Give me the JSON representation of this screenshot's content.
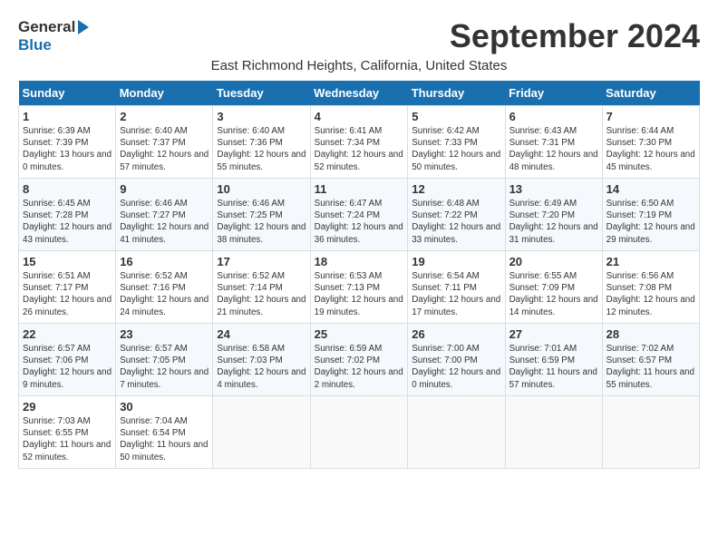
{
  "header": {
    "logo_line1": "General",
    "logo_line2": "Blue",
    "title": "September 2024",
    "location": "East Richmond Heights, California, United States"
  },
  "days_of_week": [
    "Sunday",
    "Monday",
    "Tuesday",
    "Wednesday",
    "Thursday",
    "Friday",
    "Saturday"
  ],
  "weeks": [
    [
      {
        "day": "1",
        "sunrise": "Sunrise: 6:39 AM",
        "sunset": "Sunset: 7:39 PM",
        "daylight": "Daylight: 13 hours and 0 minutes."
      },
      {
        "day": "2",
        "sunrise": "Sunrise: 6:40 AM",
        "sunset": "Sunset: 7:37 PM",
        "daylight": "Daylight: 12 hours and 57 minutes."
      },
      {
        "day": "3",
        "sunrise": "Sunrise: 6:40 AM",
        "sunset": "Sunset: 7:36 PM",
        "daylight": "Daylight: 12 hours and 55 minutes."
      },
      {
        "day": "4",
        "sunrise": "Sunrise: 6:41 AM",
        "sunset": "Sunset: 7:34 PM",
        "daylight": "Daylight: 12 hours and 52 minutes."
      },
      {
        "day": "5",
        "sunrise": "Sunrise: 6:42 AM",
        "sunset": "Sunset: 7:33 PM",
        "daylight": "Daylight: 12 hours and 50 minutes."
      },
      {
        "day": "6",
        "sunrise": "Sunrise: 6:43 AM",
        "sunset": "Sunset: 7:31 PM",
        "daylight": "Daylight: 12 hours and 48 minutes."
      },
      {
        "day": "7",
        "sunrise": "Sunrise: 6:44 AM",
        "sunset": "Sunset: 7:30 PM",
        "daylight": "Daylight: 12 hours and 45 minutes."
      }
    ],
    [
      {
        "day": "8",
        "sunrise": "Sunrise: 6:45 AM",
        "sunset": "Sunset: 7:28 PM",
        "daylight": "Daylight: 12 hours and 43 minutes."
      },
      {
        "day": "9",
        "sunrise": "Sunrise: 6:46 AM",
        "sunset": "Sunset: 7:27 PM",
        "daylight": "Daylight: 12 hours and 41 minutes."
      },
      {
        "day": "10",
        "sunrise": "Sunrise: 6:46 AM",
        "sunset": "Sunset: 7:25 PM",
        "daylight": "Daylight: 12 hours and 38 minutes."
      },
      {
        "day": "11",
        "sunrise": "Sunrise: 6:47 AM",
        "sunset": "Sunset: 7:24 PM",
        "daylight": "Daylight: 12 hours and 36 minutes."
      },
      {
        "day": "12",
        "sunrise": "Sunrise: 6:48 AM",
        "sunset": "Sunset: 7:22 PM",
        "daylight": "Daylight: 12 hours and 33 minutes."
      },
      {
        "day": "13",
        "sunrise": "Sunrise: 6:49 AM",
        "sunset": "Sunset: 7:20 PM",
        "daylight": "Daylight: 12 hours and 31 minutes."
      },
      {
        "day": "14",
        "sunrise": "Sunrise: 6:50 AM",
        "sunset": "Sunset: 7:19 PM",
        "daylight": "Daylight: 12 hours and 29 minutes."
      }
    ],
    [
      {
        "day": "15",
        "sunrise": "Sunrise: 6:51 AM",
        "sunset": "Sunset: 7:17 PM",
        "daylight": "Daylight: 12 hours and 26 minutes."
      },
      {
        "day": "16",
        "sunrise": "Sunrise: 6:52 AM",
        "sunset": "Sunset: 7:16 PM",
        "daylight": "Daylight: 12 hours and 24 minutes."
      },
      {
        "day": "17",
        "sunrise": "Sunrise: 6:52 AM",
        "sunset": "Sunset: 7:14 PM",
        "daylight": "Daylight: 12 hours and 21 minutes."
      },
      {
        "day": "18",
        "sunrise": "Sunrise: 6:53 AM",
        "sunset": "Sunset: 7:13 PM",
        "daylight": "Daylight: 12 hours and 19 minutes."
      },
      {
        "day": "19",
        "sunrise": "Sunrise: 6:54 AM",
        "sunset": "Sunset: 7:11 PM",
        "daylight": "Daylight: 12 hours and 17 minutes."
      },
      {
        "day": "20",
        "sunrise": "Sunrise: 6:55 AM",
        "sunset": "Sunset: 7:09 PM",
        "daylight": "Daylight: 12 hours and 14 minutes."
      },
      {
        "day": "21",
        "sunrise": "Sunrise: 6:56 AM",
        "sunset": "Sunset: 7:08 PM",
        "daylight": "Daylight: 12 hours and 12 minutes."
      }
    ],
    [
      {
        "day": "22",
        "sunrise": "Sunrise: 6:57 AM",
        "sunset": "Sunset: 7:06 PM",
        "daylight": "Daylight: 12 hours and 9 minutes."
      },
      {
        "day": "23",
        "sunrise": "Sunrise: 6:57 AM",
        "sunset": "Sunset: 7:05 PM",
        "daylight": "Daylight: 12 hours and 7 minutes."
      },
      {
        "day": "24",
        "sunrise": "Sunrise: 6:58 AM",
        "sunset": "Sunset: 7:03 PM",
        "daylight": "Daylight: 12 hours and 4 minutes."
      },
      {
        "day": "25",
        "sunrise": "Sunrise: 6:59 AM",
        "sunset": "Sunset: 7:02 PM",
        "daylight": "Daylight: 12 hours and 2 minutes."
      },
      {
        "day": "26",
        "sunrise": "Sunrise: 7:00 AM",
        "sunset": "Sunset: 7:00 PM",
        "daylight": "Daylight: 12 hours and 0 minutes."
      },
      {
        "day": "27",
        "sunrise": "Sunrise: 7:01 AM",
        "sunset": "Sunset: 6:59 PM",
        "daylight": "Daylight: 11 hours and 57 minutes."
      },
      {
        "day": "28",
        "sunrise": "Sunrise: 7:02 AM",
        "sunset": "Sunset: 6:57 PM",
        "daylight": "Daylight: 11 hours and 55 minutes."
      }
    ],
    [
      {
        "day": "29",
        "sunrise": "Sunrise: 7:03 AM",
        "sunset": "Sunset: 6:55 PM",
        "daylight": "Daylight: 11 hours and 52 minutes."
      },
      {
        "day": "30",
        "sunrise": "Sunrise: 7:04 AM",
        "sunset": "Sunset: 6:54 PM",
        "daylight": "Daylight: 11 hours and 50 minutes."
      },
      null,
      null,
      null,
      null,
      null
    ]
  ]
}
